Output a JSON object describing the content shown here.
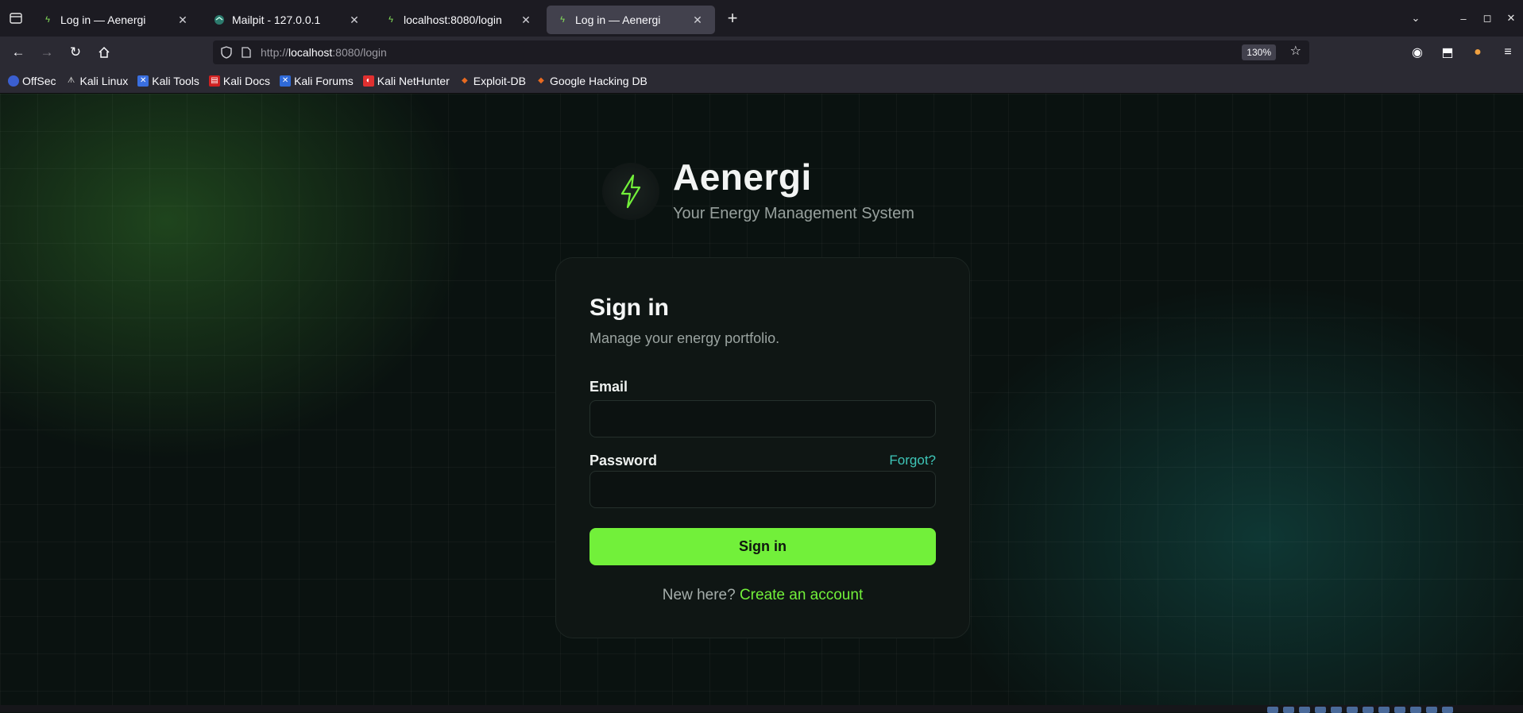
{
  "browser": {
    "tabs": [
      {
        "title": "Log in — Aenergi",
        "active": false
      },
      {
        "title": "Mailpit - 127.0.0.1",
        "active": false
      },
      {
        "title": "localhost:8080/login",
        "active": false
      },
      {
        "title": "Log in — Aenergi",
        "active": true
      }
    ],
    "url_scheme": "http://",
    "url_host": "localhost",
    "url_rest": ":8080/login",
    "zoom": "130%",
    "bookmarks": [
      "OffSec",
      "Kali Linux",
      "Kali Tools",
      "Kali Docs",
      "Kali Forums",
      "Kali NetHunter",
      "Exploit-DB",
      "Google Hacking DB"
    ]
  },
  "brand": {
    "name": "Aenergi",
    "tagline": "Your Energy Management System",
    "logo_icon": "lightning-bolt-icon",
    "accent": "#72f03a"
  },
  "form": {
    "title": "Sign in",
    "subtitle": "Manage your energy portfolio.",
    "email_label": "Email",
    "email_value": "",
    "password_label": "Password",
    "password_value": "",
    "forgot_label": "Forgot?",
    "submit_label": "Sign in",
    "signup_prompt": "New here?",
    "signup_link": "Create an account"
  }
}
